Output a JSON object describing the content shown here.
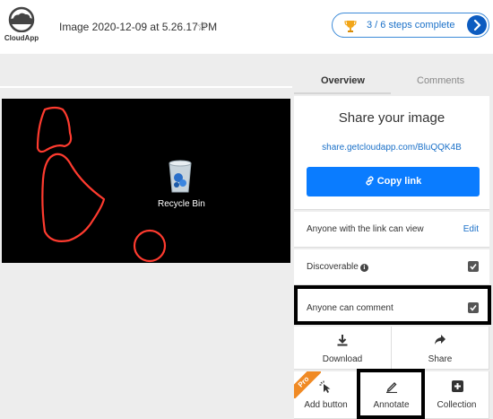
{
  "app": {
    "logo_text": "CloudApp",
    "title": "Image 2020-12-09 at 5.26.17 PM"
  },
  "icons": {
    "logo": "cloud-icon",
    "favorite": "star-outline-icon",
    "steps": "trophy-icon",
    "steps_next": "chevron-right-icon",
    "copy": "link-icon",
    "discoverable_info": "info-icon",
    "download": "download-icon",
    "share": "share-arrow-icon",
    "add_button": "cursor-click-icon",
    "annotate": "pen-icon",
    "collection": "plus-square-icon",
    "desktop_item": "recycle-bin-icon"
  },
  "progress": {
    "label": "3 / 6 steps complete",
    "completed": 3,
    "total": 6
  },
  "tabs": [
    {
      "label": "Overview",
      "active": true
    },
    {
      "label": "Comments",
      "active": false
    }
  ],
  "share": {
    "title": "Share your image",
    "link": "share.getcloudapp.com/BluQQK4B",
    "copy_label": "Copy link"
  },
  "settings": {
    "view_access": "Anyone with the link can view",
    "edit_label": "Edit",
    "discoverable_label": "Discoverable",
    "discoverable_checked": true,
    "comment_label": "Anyone can comment",
    "comment_checked": true
  },
  "actions": {
    "download": "Download",
    "share": "Share",
    "add_button": "Add button",
    "add_button_badge": "Pro",
    "annotate": "Annotate",
    "collection": "Collection"
  },
  "image": {
    "desktop_label": "Recycle Bin"
  },
  "colors": {
    "accent": "#0a7cff",
    "link": "#1a70c8",
    "pro_badge": "#f08a24",
    "annotation": "#ff3b2f"
  }
}
